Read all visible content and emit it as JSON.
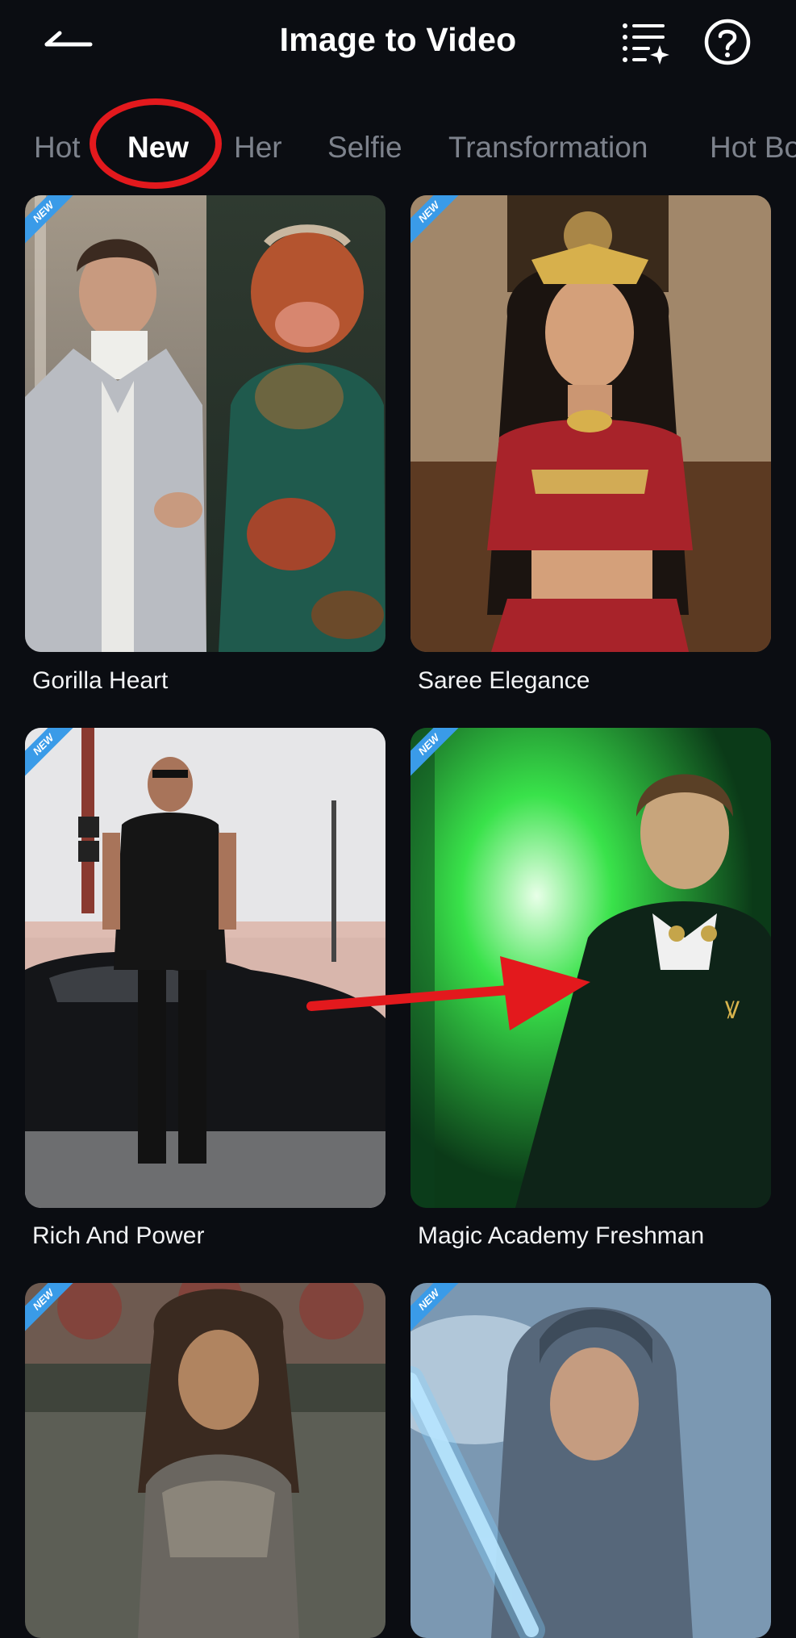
{
  "header": {
    "title": "Image to Video",
    "back_icon": "back-arrow-icon",
    "list_icon": "sparkle-list-icon",
    "help_icon": "question-mark-icon"
  },
  "tabs": [
    {
      "label": "Hot",
      "active": false
    },
    {
      "label": "New",
      "active": true
    },
    {
      "label": "Her",
      "active": false
    },
    {
      "label": "Selfie",
      "active": false
    },
    {
      "label": "Transformation",
      "active": false
    },
    {
      "label": "Hot Bo",
      "active": false
    }
  ],
  "badge_text": "NEW",
  "cards": [
    {
      "label": "Gorilla Heart"
    },
    {
      "label": "Saree Elegance"
    },
    {
      "label": "Rich And Power"
    },
    {
      "label": "Magic Academy Freshman"
    },
    {
      "label": ""
    },
    {
      "label": ""
    }
  ],
  "colors": {
    "background": "#0b0d12",
    "active_tab": "#ffffff",
    "inactive_tab": "#7d828c",
    "annotation_red": "#e3191d",
    "badge_blue": "#3a9be8"
  }
}
